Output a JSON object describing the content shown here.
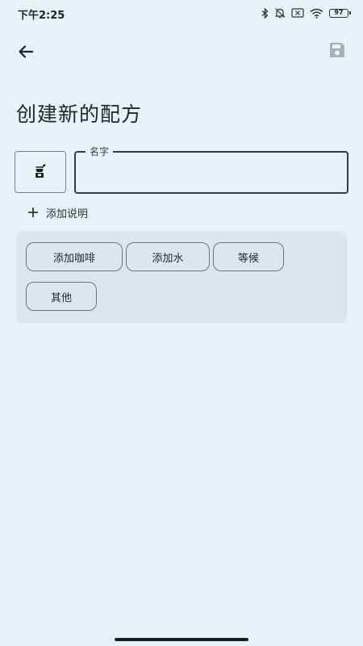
{
  "status_bar": {
    "time": "下午2:25",
    "battery": "97",
    "icons": [
      "bluetooth-icon",
      "mute-bell-icon",
      "sim-off-icon",
      "wifi-icon",
      "battery-icon"
    ]
  },
  "toolbar": {
    "back_icon": "arrow-left-icon",
    "save_icon": "floppy-disk-icon"
  },
  "page": {
    "title": "创建新的配方"
  },
  "form": {
    "recipe_icon": "coffee-grinder-icon",
    "name_label": "名字",
    "name_value": "",
    "add_description_label": "添加说明"
  },
  "steps": {
    "add_coffee": "添加咖啡",
    "add_water": "添加水",
    "wait": "等候",
    "other": "其他"
  },
  "colors": {
    "background": "#e8f1f5",
    "field_border": "#2f4148",
    "card_background": "#dee5ec",
    "save_icon_disabled": "#a9b0b4"
  }
}
